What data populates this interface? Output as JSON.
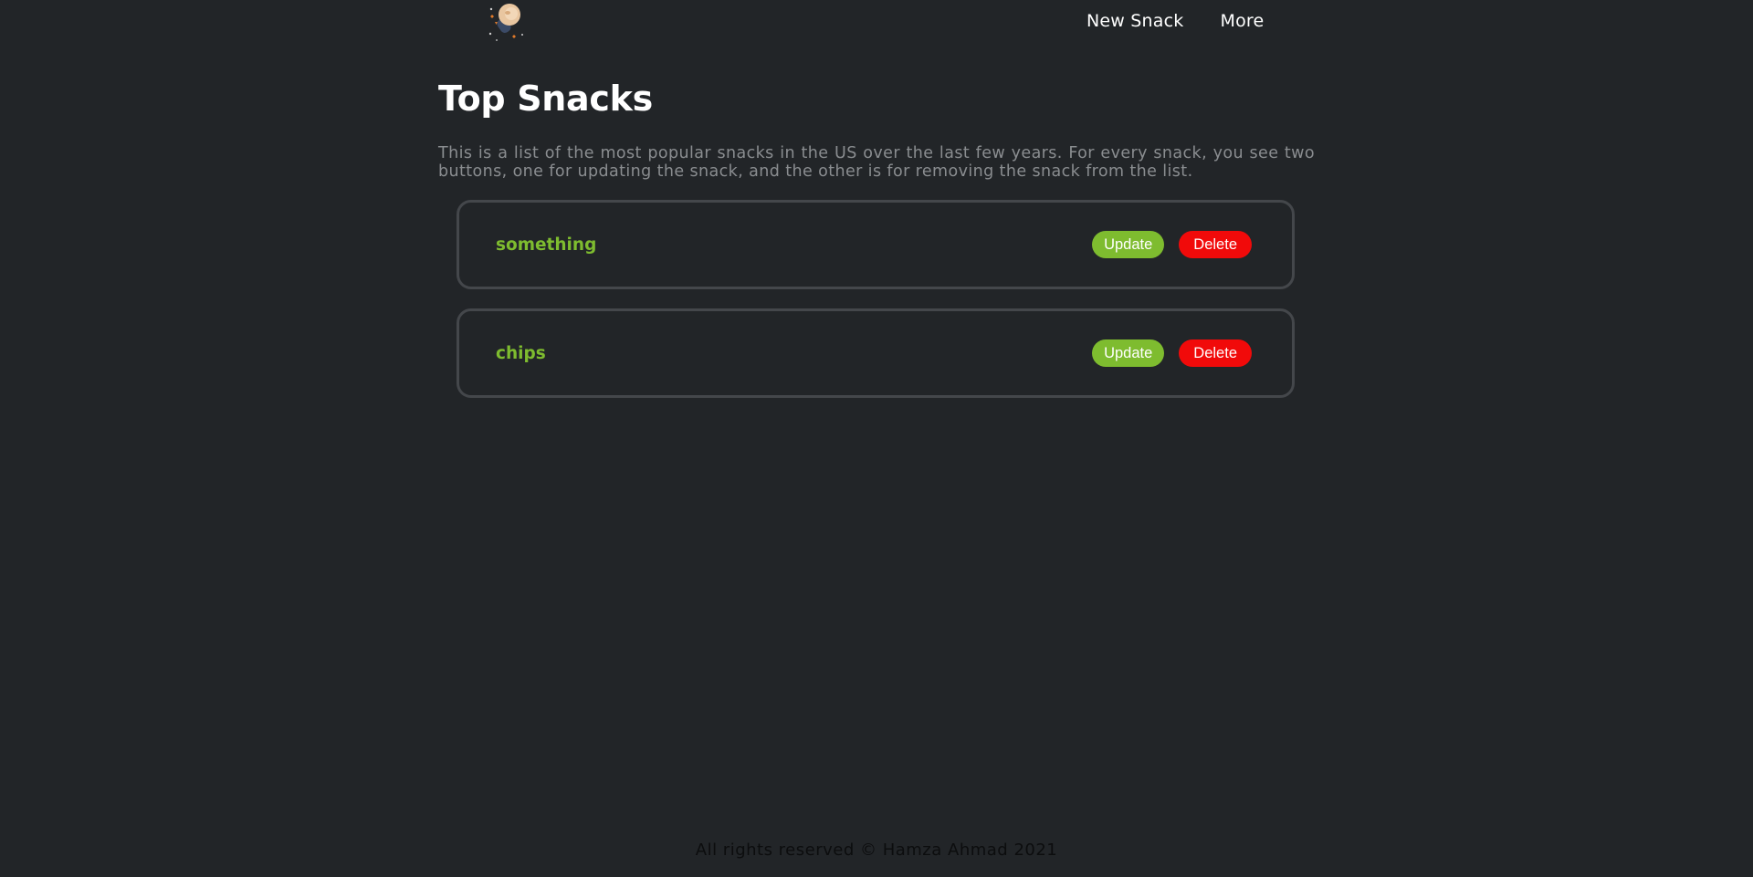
{
  "nav": {
    "logo_icon": "astronaut-logo-icon",
    "links": [
      "New Snack",
      "More"
    ]
  },
  "main": {
    "title": "Top Snacks",
    "description": "This is a list of the most popular snacks in the US over the last few years. For every snack, you see two buttons, one for updating the snack, and the other is for removing the snack from the list.",
    "snacks": [
      {
        "name": "something",
        "update_label": "Update",
        "delete_label": "Delete"
      },
      {
        "name": "chips",
        "update_label": "Update",
        "delete_label": "Delete"
      }
    ]
  },
  "footer": {
    "text": "All rights reserved © Hamza Ahmad 2021"
  },
  "colors": {
    "background": "#222528",
    "accent_green": "#7ebc2f",
    "delete_red": "#f10a0a",
    "card_border": "#44474b"
  }
}
